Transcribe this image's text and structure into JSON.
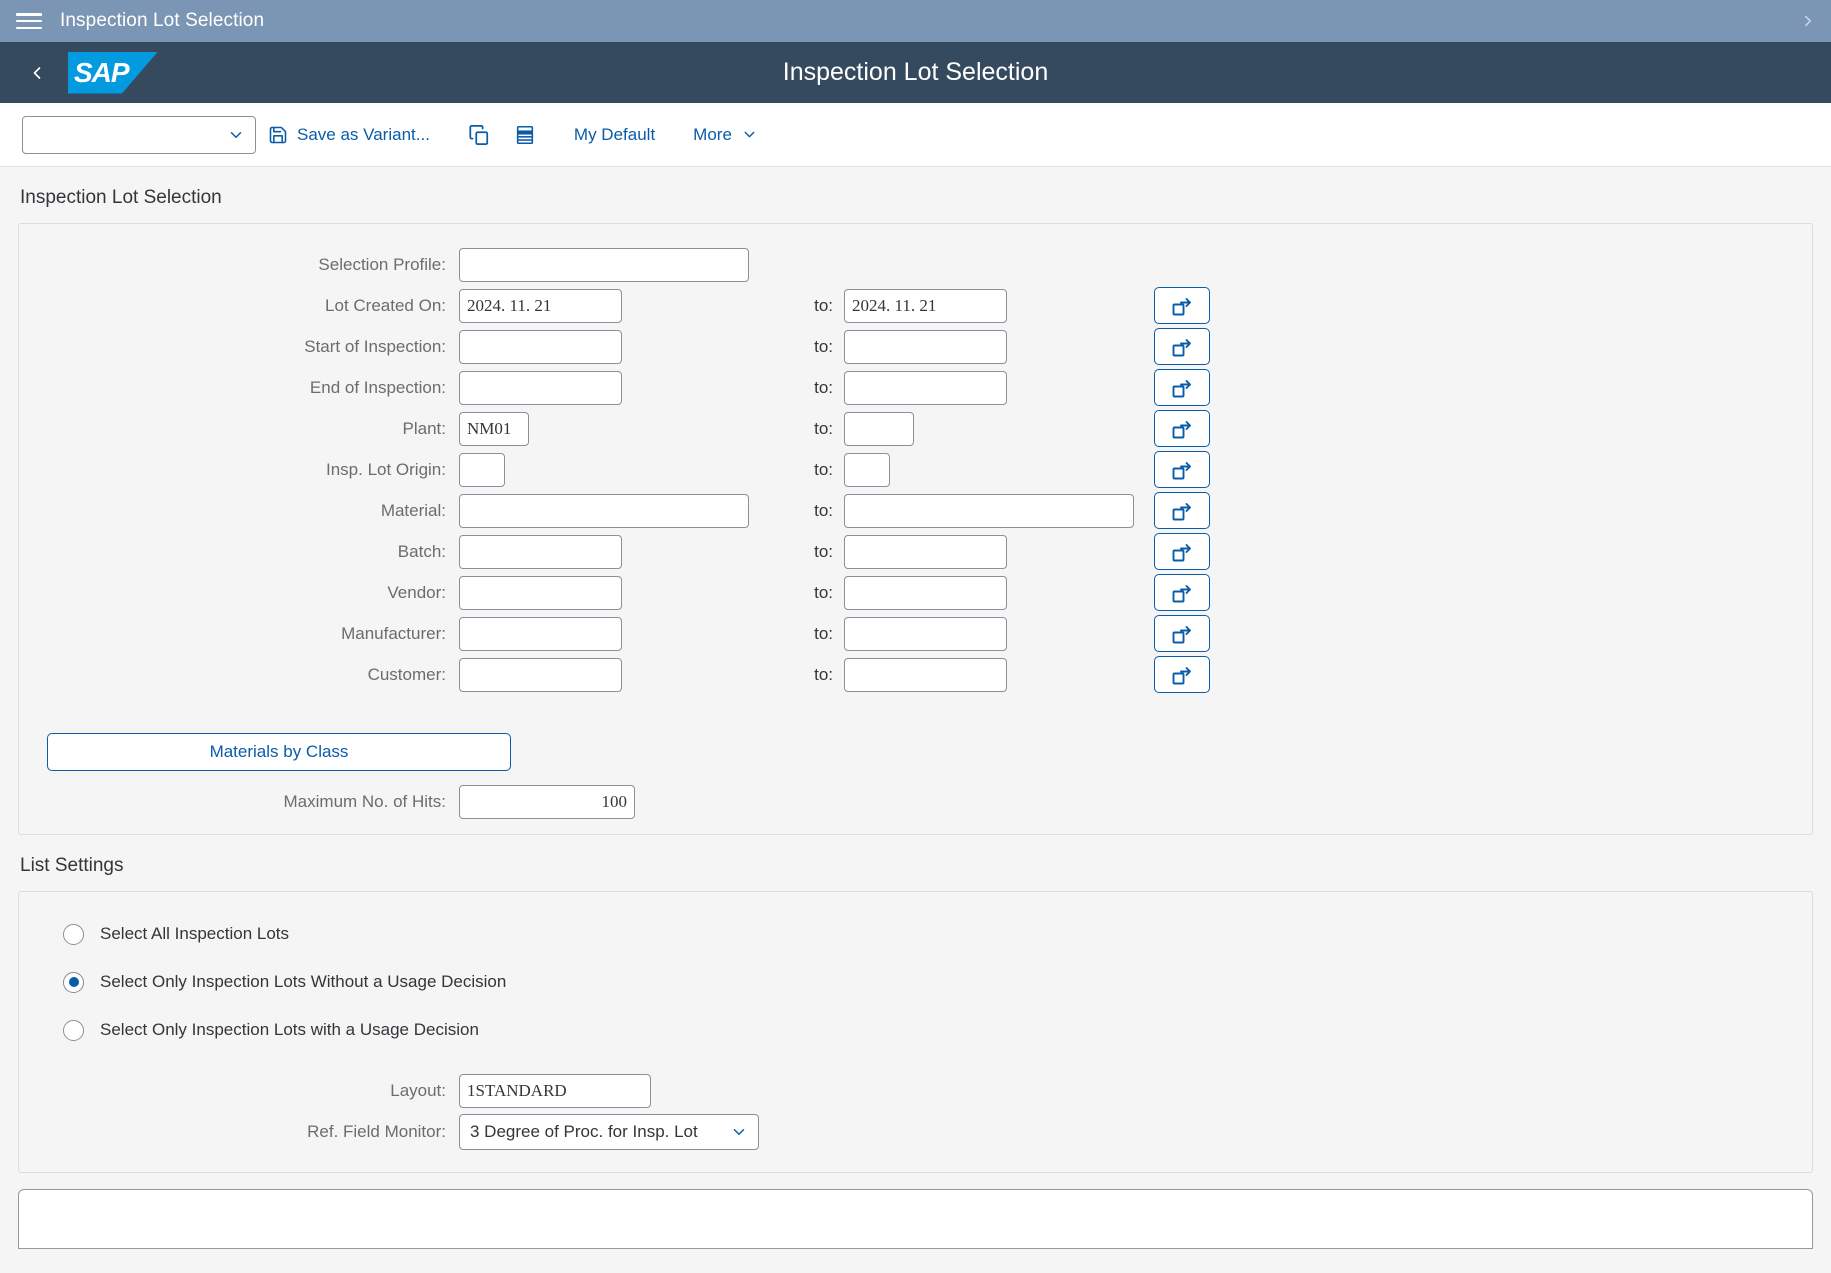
{
  "topbar": {
    "title": "Inspection Lot Selection",
    "menu_icon": "hamburger-icon",
    "expand_icon": "chevron-right-icon"
  },
  "shellbar": {
    "back_icon": "chevron-left-icon",
    "logo_text": "SAP",
    "title": "Inspection Lot Selection"
  },
  "toolbar": {
    "variant_value": "",
    "variant_placeholder": "",
    "save_variant_label": "Save as Variant...",
    "copy_icon": "copy-icon",
    "table_icon": "table-view-icon",
    "my_default_label": "My Default",
    "more_label": "More"
  },
  "selection": {
    "section_title": "Inspection Lot Selection",
    "rows": [
      {
        "label": "Selection Profile:",
        "value": "",
        "size": "w-xl",
        "has_to": false,
        "has_multi": false
      },
      {
        "label": "Lot Created On:",
        "value": "2024. 11. 21",
        "to_value": "2024. 11. 21",
        "size": "w-lg",
        "has_to": true,
        "has_multi": true
      },
      {
        "label": "Start of Inspection:",
        "value": "",
        "to_value": "",
        "size": "w-lg",
        "has_to": true,
        "has_multi": true
      },
      {
        "label": "End of Inspection:",
        "value": "",
        "to_value": "",
        "size": "w-lg",
        "has_to": true,
        "has_multi": true
      },
      {
        "label": "Plant:",
        "value": "NM01",
        "to_value": "",
        "size": "w-md",
        "has_to": true,
        "has_multi": true
      },
      {
        "label": "Insp. Lot Origin:",
        "value": "",
        "to_value": "",
        "size": "w-sm",
        "has_to": true,
        "has_multi": true
      },
      {
        "label": "Material:",
        "value": "",
        "to_value": "",
        "size": "w-xl",
        "has_to": true,
        "has_multi": true
      },
      {
        "label": "Batch:",
        "value": "",
        "to_value": "",
        "size": "w-lg",
        "has_to": true,
        "has_multi": true
      },
      {
        "label": "Vendor:",
        "value": "",
        "to_value": "",
        "size": "w-lg",
        "has_to": true,
        "has_multi": true
      },
      {
        "label": "Manufacturer:",
        "value": "",
        "to_value": "",
        "size": "w-lg",
        "has_to": true,
        "has_multi": true
      },
      {
        "label": "Customer:",
        "value": "",
        "to_value": "",
        "size": "w-lg",
        "has_to": true,
        "has_multi": true
      }
    ],
    "to_label": "to:",
    "materials_by_class_label": "Materials by Class",
    "max_hits_label": "Maximum No. of Hits:",
    "max_hits_value": "100",
    "multi_select_icon": "multi-selection-icon"
  },
  "list_settings": {
    "section_title": "List Settings",
    "options": [
      {
        "label": "Select All Inspection Lots",
        "selected": false
      },
      {
        "label": "Select Only Inspection Lots Without a Usage Decision",
        "selected": true
      },
      {
        "label": "Select Only Inspection Lots with a Usage Decision",
        "selected": false
      }
    ],
    "layout_label": "Layout:",
    "layout_value": "1STANDARD",
    "ref_field_label": "Ref. Field Monitor:",
    "ref_field_value": "3 Degree of Proc. for Insp. Lot",
    "dropdown_icon": "chevron-down-icon"
  },
  "colors": {
    "topbar_bg": "#7b96b4",
    "shellbar_bg": "#354a5f",
    "accent_blue": "#0a5ca8",
    "sap_logo_blue": "#039ae0",
    "content_bg": "#f5f5f5"
  }
}
